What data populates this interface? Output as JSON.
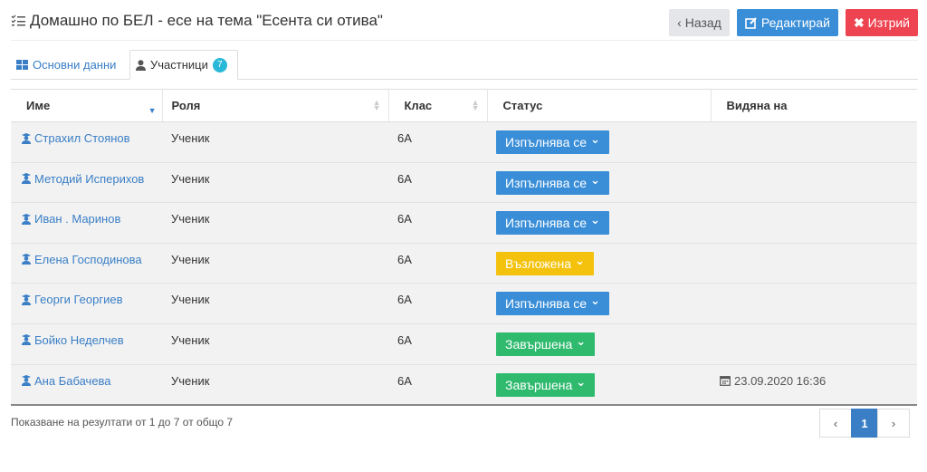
{
  "header": {
    "title": "Домашно по БЕЛ - есе на тема \"Есента си отива\"",
    "back_label": "Назад",
    "edit_label": "Редактирай",
    "delete_label": "Изтрий"
  },
  "tabs": [
    {
      "label": "Основни данни"
    },
    {
      "label": "Участници",
      "badge": "7"
    }
  ],
  "table": {
    "columns": [
      "Име",
      "Роля",
      "Клас",
      "Статус",
      "Видяна на"
    ],
    "rows": [
      {
        "name": "Страхил Стоянов",
        "role": "Ученик",
        "class": "6А",
        "status": "Изпълнява се",
        "seen": ""
      },
      {
        "name": "Методий Исперихов",
        "role": "Ученик",
        "class": "6А",
        "status": "Изпълнява се",
        "seen": ""
      },
      {
        "name": "Иван . Маринов",
        "role": "Ученик",
        "class": "6А",
        "status": "Изпълнява се",
        "seen": ""
      },
      {
        "name": "Елена Господинова",
        "role": "Ученик",
        "class": "6А",
        "status": "Възложена",
        "seen": ""
      },
      {
        "name": "Георги Георгиев",
        "role": "Ученик",
        "class": "6А",
        "status": "Изпълнява се",
        "seen": ""
      },
      {
        "name": "Бойко Неделчев",
        "role": "Ученик",
        "class": "6А",
        "status": "Завършена",
        "seen": ""
      },
      {
        "name": "Ана Бабачева",
        "role": "Ученик",
        "class": "6А",
        "status": "Завършена",
        "seen": "23.09.2020 16:36"
      }
    ]
  },
  "footer": {
    "info": "Показване на резултати от 1 до 7 от общо 7",
    "prev": "‹",
    "page": "1",
    "next": "›"
  },
  "colors": {
    "in_progress": "#3a8ed8",
    "assigned": "#f4c20d",
    "completed": "#2fba6e",
    "delete": "#ee4451",
    "link": "#3a7fc6"
  }
}
